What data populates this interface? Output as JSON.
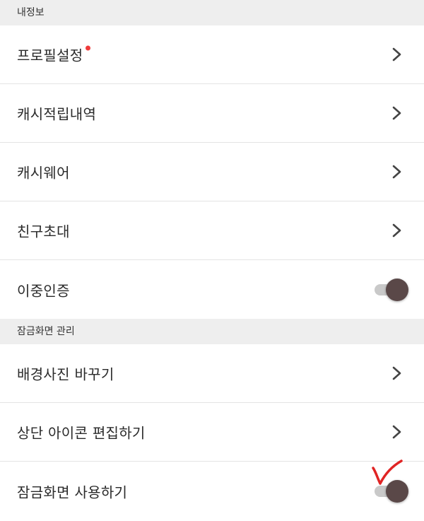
{
  "sections": [
    {
      "header": "내정보",
      "items": [
        {
          "label": "프로필설정",
          "control": "chevron",
          "badge": "new-dot"
        },
        {
          "label": "캐시적립내역",
          "control": "chevron"
        },
        {
          "label": "캐시웨어",
          "control": "chevron"
        },
        {
          "label": "친구초대",
          "control": "chevron"
        },
        {
          "label": "이중인증",
          "control": "toggle",
          "state": "on"
        }
      ]
    },
    {
      "header": "잠금화면 관리",
      "items": [
        {
          "label": "배경사진 바꾸기",
          "control": "chevron"
        },
        {
          "label": "상단 아이콘 편집하기",
          "control": "chevron"
        },
        {
          "label": "잠금화면 사용하기",
          "control": "toggle",
          "state": "on"
        }
      ]
    }
  ],
  "colors": {
    "header_bg": "#eeeeee",
    "badge": "#ef3b3b",
    "toggle_knob": "#5a4848",
    "toggle_track": "#c9c9c9",
    "annotation": "#e02424"
  },
  "annotation": {
    "icon": "red-checkmark-icon"
  }
}
